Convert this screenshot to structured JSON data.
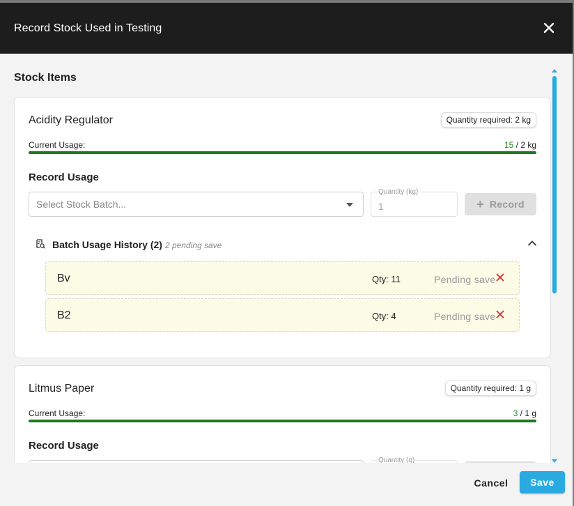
{
  "dialog": {
    "title": "Record Stock Used in Testing",
    "close_icon": "close-icon"
  },
  "section_title": "Stock Items",
  "items": [
    {
      "name": "Acidity Regulator",
      "quantity_required": "Quantity required: 2 kg",
      "usage_label": "Current Usage:",
      "usage_used": "15",
      "usage_total": " / 2 kg",
      "usage_fraction": 1.0,
      "record_usage_title": "Record Usage",
      "batch_placeholder": "Select Stock Batch...",
      "qty_label": "Quantity (kg)",
      "qty_value": "1",
      "record_button": "Record",
      "history_title": "Batch Usage History (2)",
      "history_pending": "2 pending save",
      "batches": [
        {
          "name": "Bv",
          "qty": "Qty: 11",
          "status": "Pending save"
        },
        {
          "name": "B2",
          "qty": "Qty: 4",
          "status": "Pending save"
        }
      ]
    },
    {
      "name": "Litmus Paper",
      "quantity_required": "Quantity required: 1 g",
      "usage_label": "Current Usage:",
      "usage_used": "3",
      "usage_total": " / 1 g",
      "usage_fraction": 1.0,
      "record_usage_title": "Record Usage",
      "qty_label": "Quantity (g)"
    }
  ],
  "footer": {
    "cancel": "Cancel",
    "save": "Save"
  },
  "colors": {
    "accent": "#29abe2",
    "usage_bar": "#1f7a1f",
    "titlebar": "#1d1d1d",
    "remove": "#d32f2f"
  }
}
